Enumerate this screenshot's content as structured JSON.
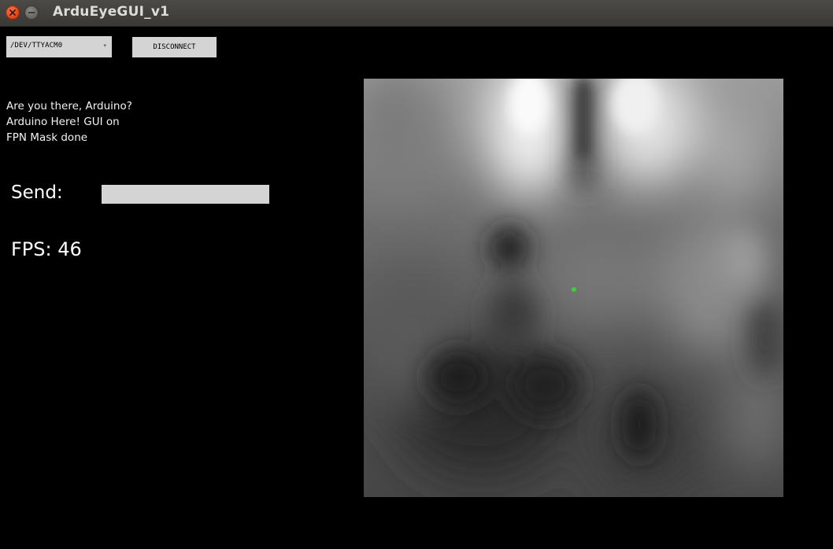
{
  "window": {
    "title": "ArduEyeGUI_v1"
  },
  "toolbar": {
    "port_value": "/DEV/TTYACM0",
    "port_caret": "▾",
    "disconnect_label": "DISCONNECT"
  },
  "console": {
    "lines": [
      "Are you there, Arduino?",
      "Arduino Here! GUI on",
      "FPN Mask done"
    ]
  },
  "send": {
    "label": "Send:",
    "value": ""
  },
  "status": {
    "fps_text": "FPS: 46"
  },
  "camera": {
    "marker_color": "#39d339"
  }
}
